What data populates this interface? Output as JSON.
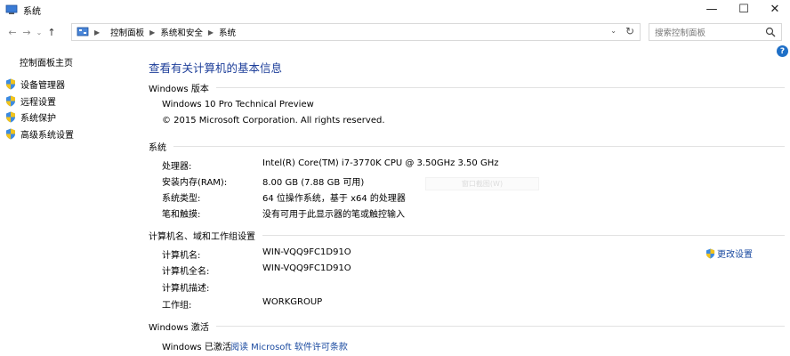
{
  "window": {
    "title": "系统"
  },
  "controls": {
    "minimize": "—",
    "maximize": "☐",
    "close": "✕"
  },
  "nav": {
    "back": "←",
    "forward": "→",
    "dropdown": "⌄",
    "up": "↑"
  },
  "address": {
    "crumbs": [
      "控制面板",
      "系统和安全",
      "系统"
    ],
    "dropdown": "⌄",
    "refresh": "↻"
  },
  "search": {
    "placeholder": "搜索控制面板"
  },
  "left": {
    "home": "控制面板主页",
    "links": [
      "设备管理器",
      "远程设置",
      "系统保护",
      "高级系统设置"
    ]
  },
  "help": "?",
  "main": {
    "title": "查看有关计算机的基本信息",
    "windows_edition": {
      "heading": "Windows 版本",
      "edition": "Windows 10 Pro Technical Preview",
      "copyright": "© 2015 Microsoft Corporation. All rights reserved."
    },
    "system": {
      "heading": "系统",
      "rows": [
        {
          "label": "处理器:",
          "value": "Intel(R) Core(TM) i7-3770K CPU @ 3.50GHz   3.50 GHz"
        },
        {
          "label": "安装内存(RAM):",
          "value": "8.00 GB (7.88 GB 可用)"
        },
        {
          "label": "系统类型:",
          "value": "64 位操作系统，基于 x64 的处理器"
        },
        {
          "label": "笔和触摸:",
          "value": "没有可用于此显示器的笔或触控输入"
        }
      ],
      "ghost_button": "窗口截图(W)"
    },
    "computer": {
      "heading": "计算机名、域和工作组设置",
      "rows": [
        {
          "label": "计算机名:",
          "value": "WIN-VQQ9FC1D91O"
        },
        {
          "label": "计算机全名:",
          "value": "WIN-VQQ9FC1D91O"
        },
        {
          "label": "计算机描述:",
          "value": ""
        },
        {
          "label": "工作组:",
          "value": "WORKGROUP"
        }
      ],
      "change_link": "更改设置"
    },
    "activation": {
      "heading": "Windows 激活",
      "status": "Windows 已激活",
      "license_link": "阅读 Microsoft 软件许可条款"
    }
  },
  "colors": {
    "title_blue": "#1e3f9a",
    "link_blue": "#1a4aa0",
    "help_blue": "#1e6fc7"
  }
}
